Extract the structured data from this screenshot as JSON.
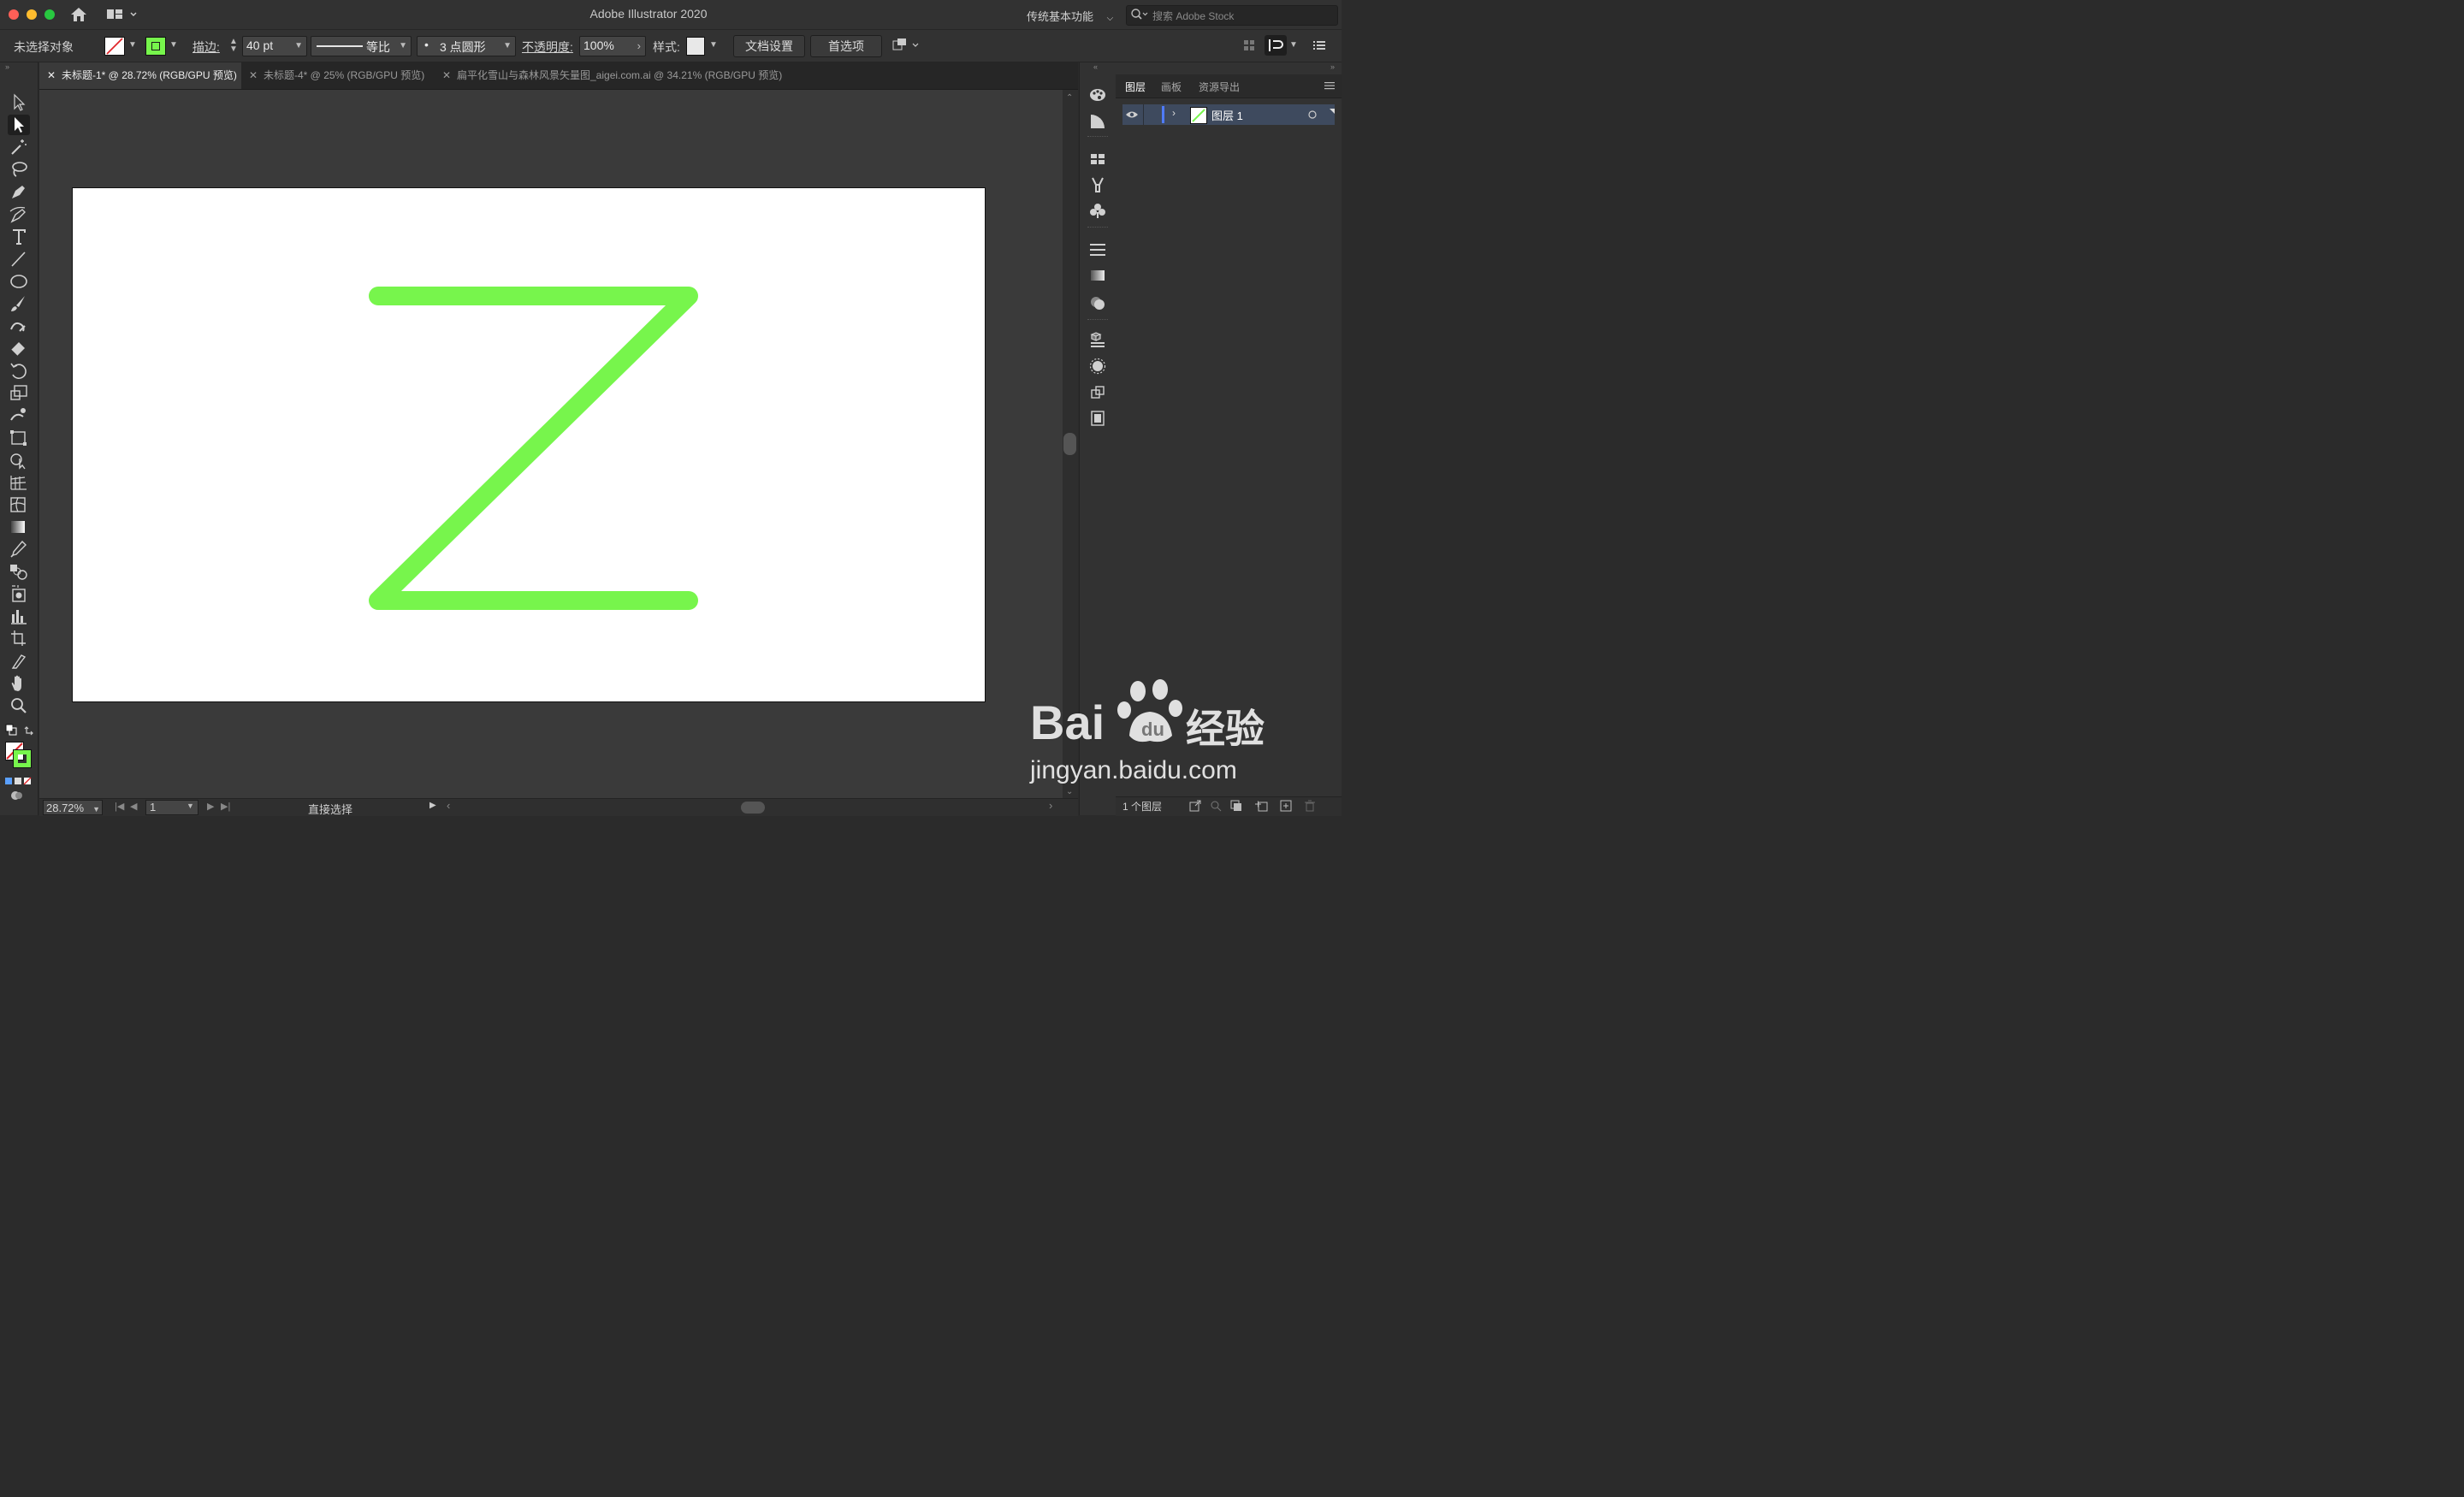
{
  "titlebar": {
    "app_title": "Adobe Illustrator 2020",
    "workspace": "传统基本功能",
    "search_placeholder": "搜索 Adobe Stock"
  },
  "controlbar": {
    "selection_status": "未选择对象",
    "stroke_label": "描边:",
    "stroke_weight": "40 pt",
    "stroke_profile": "等比",
    "brush": "3 点圆形",
    "opacity_label": "不透明度:",
    "opacity_value": "100%",
    "style_label": "样式:",
    "doc_setup_button": "文档设置",
    "preferences_button": "首选项",
    "fill_color": "none",
    "stroke_color": "#77f54c"
  },
  "tabs": [
    {
      "label": "未标题-1* @ 28.72% (RGB/GPU 预览)",
      "active": true
    },
    {
      "label": "未标题-4* @ 25% (RGB/GPU 预览)",
      "active": false
    },
    {
      "label": "扁平化雪山与森林风景矢量图_aigei.com.ai @ 34.21% (RGB/GPU 预览)",
      "active": false
    }
  ],
  "tools": [
    "selection-tool-icon",
    "direct-selection-tool-icon",
    "magic-wand-tool-icon",
    "lasso-tool-icon",
    "pen-tool-icon",
    "curvature-tool-icon",
    "type-tool-icon",
    "line-segment-tool-icon",
    "ellipse-tool-icon",
    "paintbrush-tool-icon",
    "shaper-tool-icon",
    "eraser-tool-icon",
    "rotate-tool-icon",
    "scale-tool-icon",
    "warp-tool-icon",
    "free-transform-tool-icon",
    "shape-builder-tool-icon",
    "perspective-grid-tool-icon",
    "mesh-tool-icon",
    "gradient-tool-icon",
    "eyedropper-tool-icon",
    "blend-tool-icon",
    "symbol-sprayer-tool-icon",
    "column-graph-tool-icon",
    "artboard-tool-icon",
    "slice-tool-icon",
    "hand-tool-icon",
    "zoom-tool-icon"
  ],
  "artwork": {
    "stroke_color": "#77f54c",
    "shape": "Z"
  },
  "statusbar": {
    "zoom": "28.72%",
    "artboard_number": "1",
    "current_tool": "直接选择"
  },
  "layers_panel": {
    "tabs": [
      "图层",
      "画板",
      "资源导出"
    ],
    "active_tab": "图层",
    "layers": [
      {
        "name": "图层 1",
        "visible": true
      }
    ],
    "footer_count": "1 个图层"
  },
  "watermark": {
    "brand": "Bai",
    "brand2": "经验",
    "url": "jingyan.baidu.com"
  }
}
